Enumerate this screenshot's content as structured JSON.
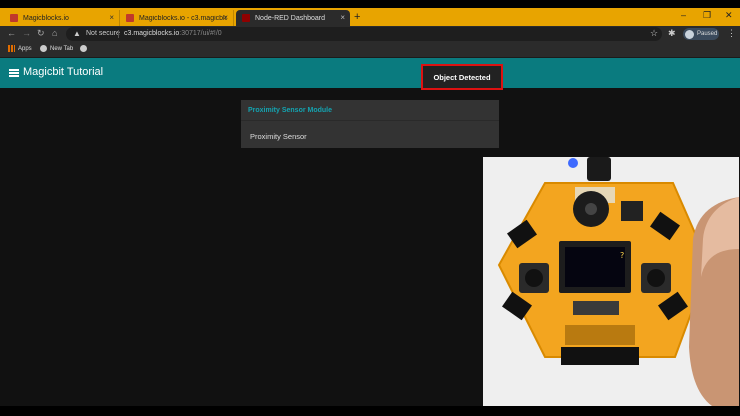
{
  "tabs": [
    {
      "label": "Magicblocks.io",
      "close": "×"
    },
    {
      "label": "Magicblocks.io - c3.magicblocks...",
      "close": "×"
    },
    {
      "label": "Node-RED Dashboard",
      "close": "×"
    }
  ],
  "new_tab_glyph": "+",
  "window_controls": {
    "minimize": "–",
    "restore": "❐",
    "close": "✕"
  },
  "addressbar": {
    "security_label": "Not secure",
    "url_host": "c3.magicblocks.io",
    "url_rest": ":30717/ui/#!/0"
  },
  "profile": {
    "label": "Paused"
  },
  "bookmarks": [
    {
      "label": "Apps"
    },
    {
      "label": "New Tab"
    }
  ],
  "app": {
    "title": "Magicbit Tutorial"
  },
  "card": {
    "title": "Proximity Sensor Module",
    "sensor_label": "Proximity Sensor",
    "status": "Object Detected"
  },
  "photo": {
    "screen_glyph": "?"
  },
  "colors": {
    "appbar": "#0a7b7f",
    "card_title": "#14a3b0",
    "highlight_border": "#dd1111",
    "tabstrip": "#e8a400"
  }
}
